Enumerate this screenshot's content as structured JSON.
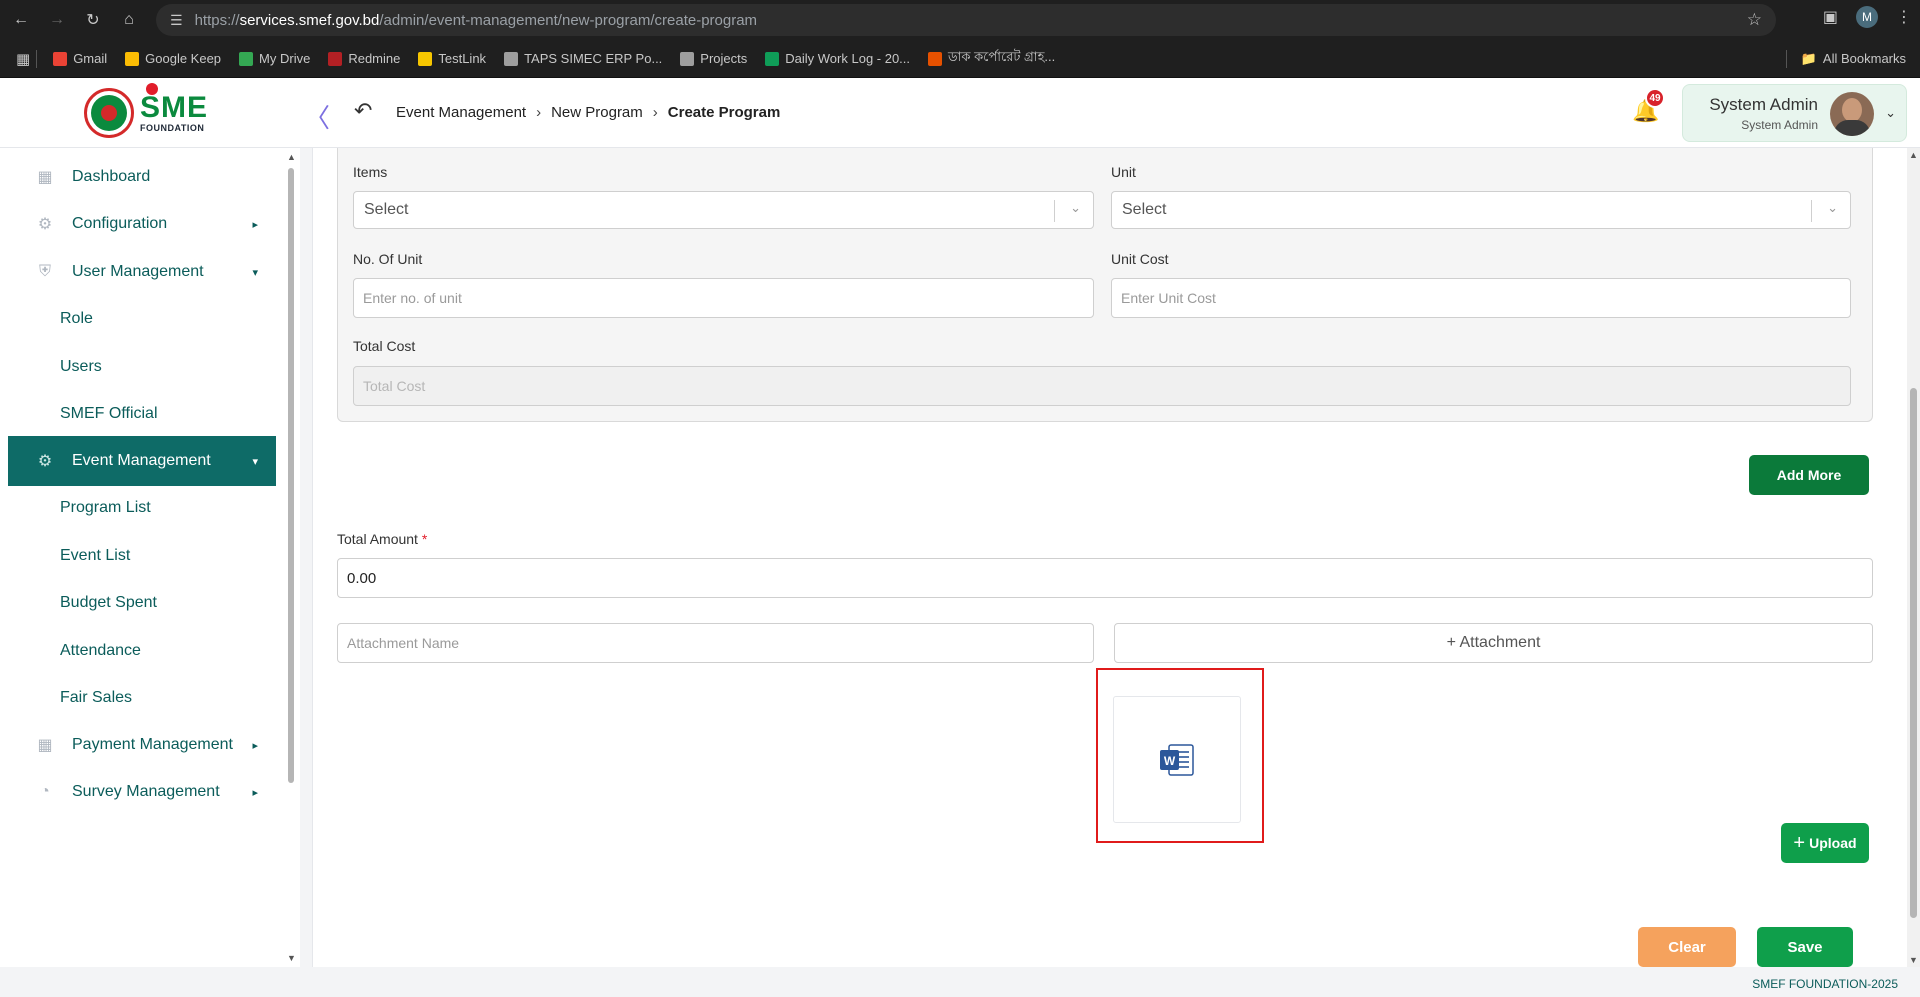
{
  "browser": {
    "url_prefix": "https://",
    "url_host": "services.smef.gov.bd",
    "url_path": "/admin/event-management/new-program/create-program",
    "profile_initial": "M"
  },
  "bookmarks": [
    {
      "label": "Gmail",
      "color": "#ea4335"
    },
    {
      "label": "Google Keep",
      "color": "#fbbc04"
    },
    {
      "label": "My Drive",
      "color": "#34a853"
    },
    {
      "label": "Redmine",
      "color": "#b32024"
    },
    {
      "label": "TestLink",
      "color": "#f7c600"
    },
    {
      "label": "TAPS SIMEC ERP Po...",
      "color": "#9e9e9e"
    },
    {
      "label": "Projects",
      "color": "#9e9e9e"
    },
    {
      "label": "Daily Work Log - 20...",
      "color": "#0f9d58"
    },
    {
      "label": "ডাক কর্পোরেট গ্রাহ...",
      "color": "#e65100"
    }
  ],
  "all_bookmarks_label": "All Bookmarks",
  "header": {
    "logo_text": "SME",
    "logo_sub": "FOUNDATION",
    "breadcrumb": [
      "Event Management",
      "New Program",
      "Create Program"
    ],
    "notification_count": "49",
    "user_name": "System Admin",
    "user_role": "System Admin"
  },
  "sidebar": {
    "items": [
      {
        "label": "Dashboard",
        "icon": "grid-icon",
        "caret": ""
      },
      {
        "label": "Configuration",
        "icon": "config-icon",
        "caret": "▸"
      },
      {
        "label": "User Management",
        "icon": "shield-icon",
        "caret": "▾"
      },
      {
        "label": "Role",
        "icon": "",
        "caret": ""
      },
      {
        "label": "Users",
        "icon": "",
        "caret": ""
      },
      {
        "label": "SMEF Official",
        "icon": "",
        "caret": ""
      },
      {
        "label": "Event Management",
        "icon": "event-icon",
        "caret": "▾"
      },
      {
        "label": "Program List",
        "icon": "",
        "caret": ""
      },
      {
        "label": "Event List",
        "icon": "",
        "caret": ""
      },
      {
        "label": "Budget Spent",
        "icon": "",
        "caret": ""
      },
      {
        "label": "Attendance",
        "icon": "",
        "caret": ""
      },
      {
        "label": "Fair Sales",
        "icon": "",
        "caret": ""
      },
      {
        "label": "Payment Management",
        "icon": "payment-icon",
        "caret": "▸"
      },
      {
        "label": "Survey Management",
        "icon": "survey-icon",
        "caret": "▸"
      }
    ]
  },
  "form": {
    "items_label": "Items",
    "items_value": "Select",
    "unit_label": "Unit",
    "unit_value": "Select",
    "no_of_unit_label": "No. Of Unit",
    "no_of_unit_placeholder": "Enter no. of unit",
    "unit_cost_label": "Unit Cost",
    "unit_cost_placeholder": "Enter Unit Cost",
    "total_cost_label": "Total Cost",
    "total_cost_placeholder": "Total Cost",
    "add_more_label": "Add More",
    "total_amount_label": "Total Amount",
    "total_amount_required": "*",
    "total_amount_value": "0.00",
    "attachment_name_placeholder": "Attachment Name",
    "attachment_button_label": "+ Attachment",
    "upload_label": "Upload",
    "clear_label": "Clear",
    "save_label": "Save"
  },
  "footer": {
    "text": "SMEF FOUNDATION-2025"
  },
  "colors": {
    "primary_green": "#0b7a3a",
    "sidebar_active": "#0e6b67",
    "clear_orange": "#f5a25d",
    "highlight_red": "#e01b1b",
    "word_blue": "#2b579a"
  }
}
